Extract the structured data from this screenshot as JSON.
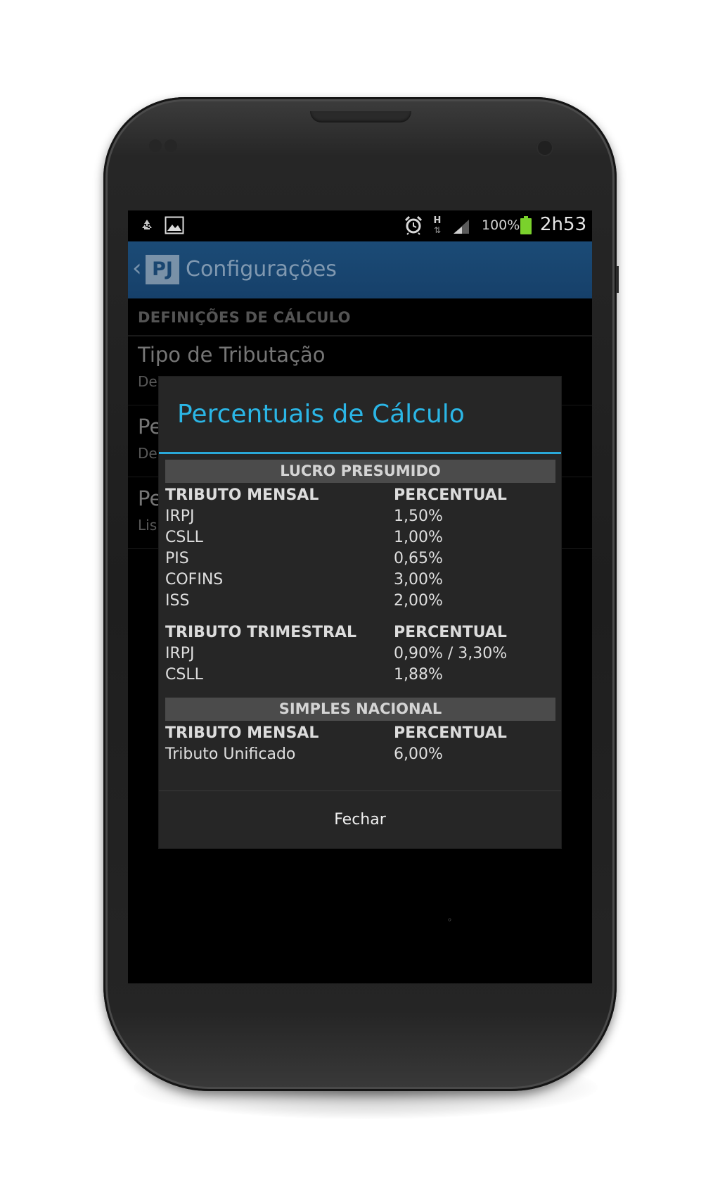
{
  "status_bar": {
    "left_icons": [
      "recycle-icon",
      "image-icon"
    ],
    "right_icons": [
      "alarm-clock-icon",
      "hspa-data-icon",
      "signal-icon",
      "battery-icon"
    ],
    "network_type": "H",
    "battery_percent": "100%",
    "battery_level": 1.0,
    "clock": "2h53",
    "battery_color": "#7ad12c"
  },
  "action_bar": {
    "back_icon": "chevron-left-icon",
    "logo_text": "PJ",
    "title": "Configurações",
    "color": "#1b4b76"
  },
  "settings": {
    "section_header": "DEFINIÇÕES DE CÁLCULO",
    "items": [
      {
        "title": "Tipo de Tributação",
        "subtitle": "De"
      },
      {
        "title": "Pe",
        "subtitle": "De"
      },
      {
        "title": "Pe",
        "subtitle": "Lis"
      }
    ]
  },
  "dialog": {
    "title": "Percentuais de Cálculo",
    "title_color": "#2bb6e6",
    "lucro_presumido": {
      "band_label": "LUCRO PRESUMIDO",
      "mensal": {
        "header": [
          "TRIBUTO MENSAL",
          "PERCENTUAL"
        ],
        "rows": [
          [
            "IRPJ",
            "1,50%"
          ],
          [
            "CSLL",
            "1,00%"
          ],
          [
            "PIS",
            "0,65%"
          ],
          [
            "COFINS",
            "3,00%"
          ],
          [
            "ISS",
            "2,00%"
          ]
        ]
      },
      "trimestral": {
        "header": [
          "TRIBUTO TRIMESTRAL",
          "PERCENTUAL"
        ],
        "rows": [
          [
            "IRPJ",
            "0,90% / 3,30%"
          ],
          [
            "CSLL",
            "1,88%"
          ]
        ]
      }
    },
    "simples_nacional": {
      "band_label": "SIMPLES NACIONAL",
      "mensal": {
        "header": [
          "TRIBUTO MENSAL",
          "PERCENTUAL"
        ],
        "rows": [
          [
            "Tributo Unificado",
            "6,00%"
          ]
        ]
      }
    },
    "close_button": "Fechar"
  }
}
